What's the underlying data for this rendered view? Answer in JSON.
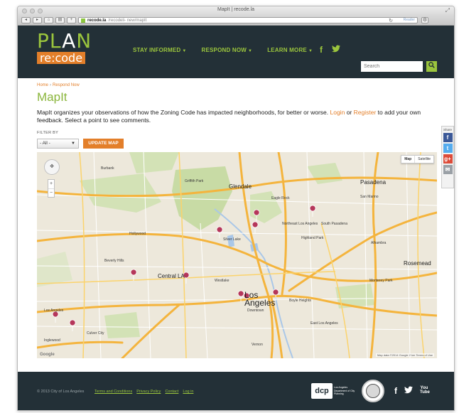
{
  "window": {
    "title": "MapIt | recode.la"
  },
  "browser": {
    "url_host": "recode.la",
    "url_path": "/recodeli- new/mapIt",
    "reader_label": "Reader"
  },
  "header": {
    "logo_plan": "PL",
    "logo_a": "A",
    "logo_n": "N",
    "logo_recode": "re:code",
    "nav": [
      {
        "label": "STAY INFORMED"
      },
      {
        "label": "RESPOND NOW"
      },
      {
        "label": "LEARN MORE"
      }
    ],
    "social": {
      "facebook": "f",
      "twitter": "t"
    },
    "search": {
      "placeholder": "Search"
    }
  },
  "breadcrumb": {
    "home": "Home",
    "separator": "›",
    "current": "Respond Now"
  },
  "page": {
    "title": "MapIt",
    "intro_before": "MapIt organizes your observations of how the Zoning Code has impacted neighborhoods, for better or worse.",
    "login_link": "Login",
    "or_text": "or",
    "register_link": "Register",
    "intro_after": "to add your own feedback. Select a point to see comments."
  },
  "filter": {
    "label": "FILTER BY",
    "selected": "- All -",
    "update_button": "UPDATE MAP"
  },
  "map": {
    "type_map": "Map",
    "type_satellite": "Satellite",
    "labels": [
      {
        "text": "Glendale",
        "size": "big"
      },
      {
        "text": "Pasadena",
        "size": "big"
      },
      {
        "text": "Central LA",
        "size": "big"
      },
      {
        "text": "Los",
        "size": "huge"
      },
      {
        "text": "Angeles",
        "size": "huge"
      },
      {
        "text": "Downtown",
        "size": "small"
      },
      {
        "text": "Northeast Los Angeles",
        "size": "small"
      },
      {
        "text": "Eagle Rock",
        "size": "small"
      },
      {
        "text": "Highland Park",
        "size": "small"
      },
      {
        "text": "Alhambra",
        "size": "small"
      },
      {
        "text": "Rosemead",
        "size": "big"
      },
      {
        "text": "Monterey Park",
        "size": "small"
      },
      {
        "text": "East Los Angeles",
        "size": "small"
      },
      {
        "text": "Hollywood",
        "size": "small"
      },
      {
        "text": "Burbank",
        "size": "small"
      },
      {
        "text": "Culver City",
        "size": "small"
      },
      {
        "text": "Beverly Hills",
        "size": "small"
      },
      {
        "text": "Griffith Park",
        "size": "small"
      },
      {
        "text": "Inglewood",
        "size": "small"
      },
      {
        "text": "Westlake",
        "size": "small"
      },
      {
        "text": "Silver Lake",
        "size": "small"
      },
      {
        "text": "Boyle Heights",
        "size": "small"
      },
      {
        "text": "San Marino",
        "size": "small"
      },
      {
        "text": "South Pasadena",
        "size": "small"
      },
      {
        "text": "Vernon",
        "size": "small"
      },
      {
        "text": "Los Angeles",
        "size": "small"
      }
    ],
    "credit": "Map data ©2014 Google   2 km    Terms of Use",
    "google_logo": "Google"
  },
  "share": {
    "title": "Share",
    "buttons": [
      {
        "name": "facebook",
        "glyph": "f",
        "color": "#3b5998"
      },
      {
        "name": "twitter",
        "glyph": "t",
        "color": "#55acee"
      },
      {
        "name": "google-plus",
        "glyph": "g+",
        "color": "#dd4b39"
      },
      {
        "name": "email",
        "glyph": "✉",
        "color": "#9aa0a6"
      }
    ]
  },
  "footer": {
    "copyright": "© 2013 City of Los Angeles",
    "links": [
      "Terms and Conditions",
      "Privacy Policy",
      "Contact",
      "Log in"
    ],
    "dcp_mark": "dcp",
    "dcp_text": "Los Angeles Department of City Planning",
    "social": {
      "facebook": "f",
      "twitter": "t",
      "youtube": "You Tube"
    }
  },
  "colors": {
    "header_bg": "#233037",
    "brand_green": "#9bc53d",
    "brand_orange": "#e37f2a",
    "marker": "#b5375a"
  }
}
